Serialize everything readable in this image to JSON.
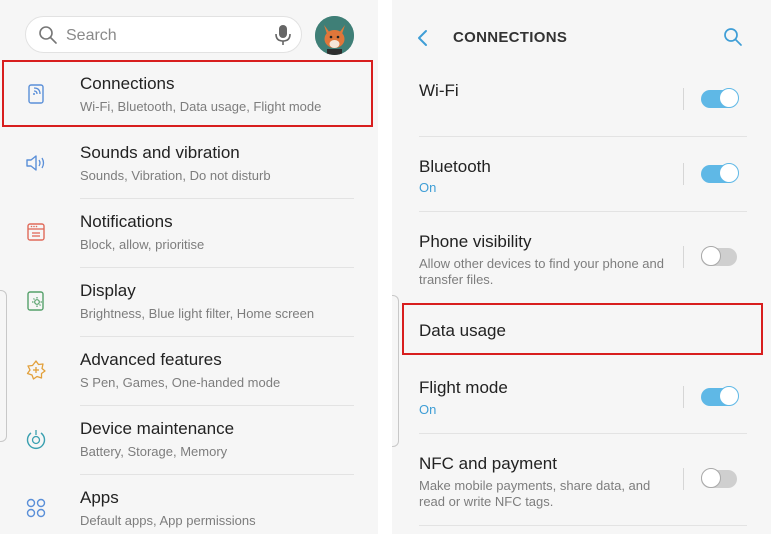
{
  "left": {
    "search": {
      "placeholder": "Search"
    },
    "items": [
      {
        "title": "Connections",
        "subtitle": "Wi-Fi, Bluetooth, Data usage, Flight mode",
        "icon": "connections-icon",
        "highlighted": true
      },
      {
        "title": "Sounds and vibration",
        "subtitle": "Sounds, Vibration, Do not disturb",
        "icon": "sound-icon"
      },
      {
        "title": "Notifications",
        "subtitle": "Block, allow, prioritise",
        "icon": "notifications-icon"
      },
      {
        "title": "Display",
        "subtitle": "Brightness, Blue light filter, Home screen",
        "icon": "display-icon"
      },
      {
        "title": "Advanced features",
        "subtitle": "S Pen, Games, One-handed mode",
        "icon": "advanced-features-icon"
      },
      {
        "title": "Device maintenance",
        "subtitle": "Battery, Storage, Memory",
        "icon": "device-maintenance-icon"
      },
      {
        "title": "Apps",
        "subtitle": "Default apps, App permissions",
        "icon": "apps-icon"
      }
    ]
  },
  "right": {
    "header": {
      "title": "CONNECTIONS"
    },
    "rows": [
      {
        "title": "Wi-Fi",
        "toggle": "on"
      },
      {
        "title": "Bluetooth",
        "status": "On",
        "toggle": "on"
      },
      {
        "title": "Phone visibility",
        "description": "Allow other devices to find your phone and transfer files.",
        "toggle": "off"
      },
      {
        "title": "Data usage",
        "highlighted": true
      },
      {
        "title": "Flight mode",
        "status": "On",
        "toggle": "on"
      },
      {
        "title": "NFC and payment",
        "description": "Make mobile payments, share data, and read or write NFC tags.",
        "toggle": "off"
      }
    ]
  },
  "colors": {
    "accent": "#5fb8e6",
    "status_text": "#3f9ed6",
    "highlight": "#d81e1e",
    "icon_blue": "#5a8fd8",
    "icon_red": "#e06a5a",
    "icon_green": "#55a06a",
    "icon_orange": "#e2a03a",
    "icon_teal": "#3aa0b0"
  }
}
